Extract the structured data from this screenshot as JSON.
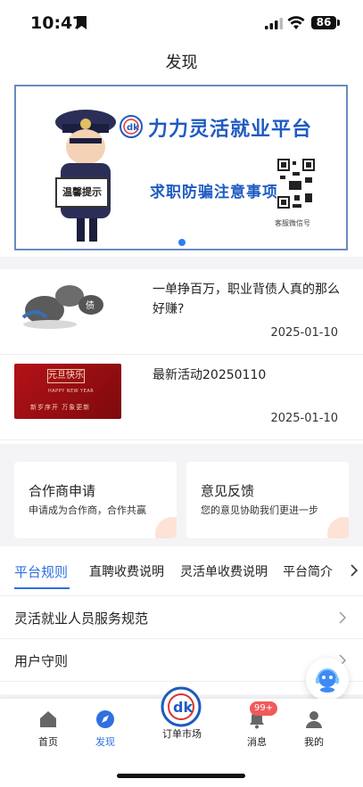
{
  "status_bar": {
    "time": "10:47",
    "battery": "86"
  },
  "header": {
    "title": "发现"
  },
  "banner": {
    "title": "力力灵活就业平台",
    "subtitle": "求职防骗注意事项",
    "sign_text": "温馨提示",
    "qr_caption": "客服微信号",
    "brand_color": "#1f5bc1"
  },
  "news": [
    {
      "title": "一单挣百万，职业背债人真的那么好赚?",
      "date": "2025-01-10"
    },
    {
      "title": "最新活动20250110",
      "date": "2025-01-10",
      "thumb_text": {
        "main": "元旦快乐",
        "en": "HAPPY NEW YEAR",
        "cn": "新岁序开  万象更新"
      }
    }
  ],
  "cards": [
    {
      "title": "合作商申请",
      "desc": "申请成为合作商，合作共赢"
    },
    {
      "title": "意见反馈",
      "desc": "您的意见协助我们更进一步"
    }
  ],
  "tabs": [
    "平台规则",
    "直聘收费说明",
    "灵活单收费说明",
    "平台简介"
  ],
  "rules": [
    "灵活就业人员服务规范",
    "用户守则"
  ],
  "tab_bar": {
    "items": [
      "首页",
      "发现",
      "订单市场",
      "消息",
      "我的"
    ],
    "badge": "99+"
  },
  "accent_color": "#2f6fe0"
}
